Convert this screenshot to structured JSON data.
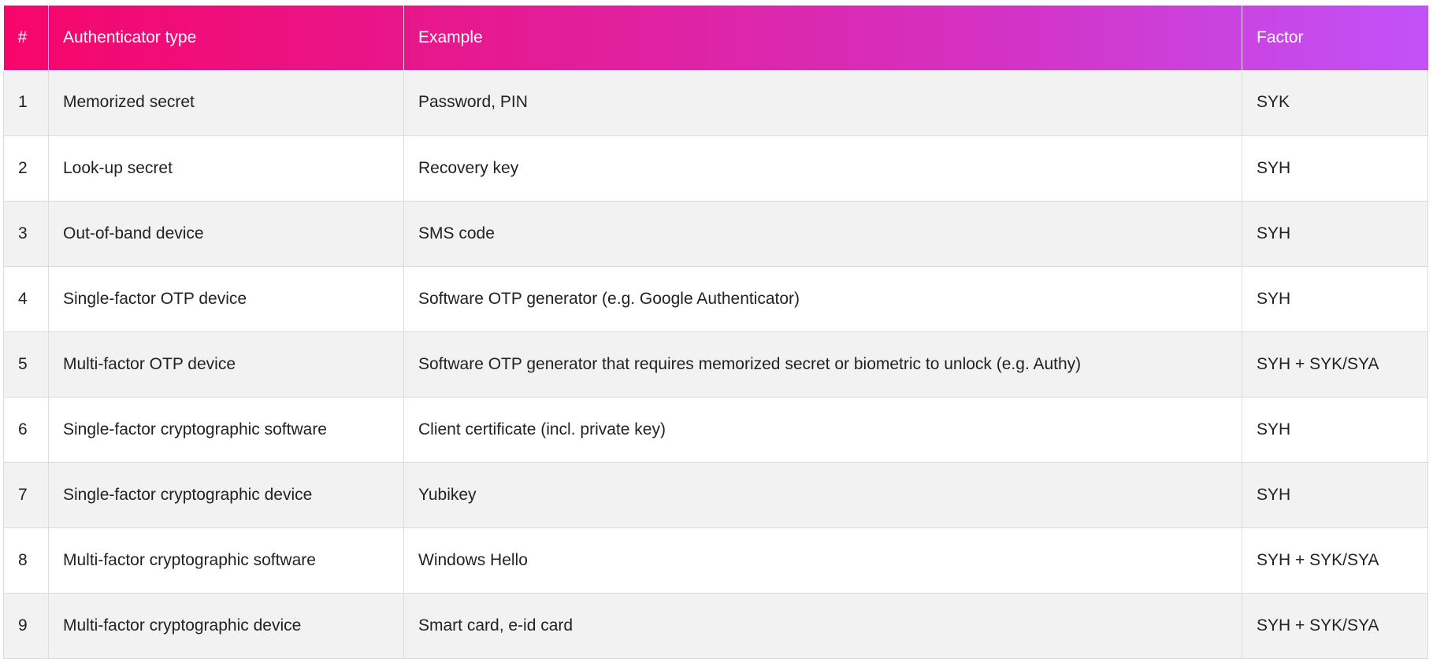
{
  "table": {
    "headers": [
      "#",
      "Authenticator type",
      "Example",
      "Factor"
    ],
    "rows": [
      [
        "1",
        "Memorized secret",
        "Password, PIN",
        "SYK"
      ],
      [
        "2",
        "Look-up secret",
        "Recovery key",
        "SYH"
      ],
      [
        "3",
        "Out-of-band device",
        "SMS code",
        "SYH"
      ],
      [
        "4",
        "Single-factor OTP device",
        "Software OTP generator (e.g. Google Authenticator)",
        "SYH"
      ],
      [
        "5",
        "Multi-factor OTP device",
        "Software OTP generator that requires memorized secret or biometric to unlock (e.g. Authy)",
        "SYH + SYK/SYA"
      ],
      [
        "6",
        "Single-factor cryptographic software",
        "Client certificate (incl. private key)",
        "SYH"
      ],
      [
        "7",
        "Single-factor cryptographic device",
        "Yubikey",
        "SYH"
      ],
      [
        "8",
        "Multi-factor cryptographic software",
        "Windows Hello",
        "SYH + SYK/SYA"
      ],
      [
        "9",
        "Multi-factor cryptographic device",
        "Smart card, e-id card",
        "SYH + SYK/SYA"
      ]
    ]
  },
  "colors": {
    "header_gradient_start": "#f6066b",
    "header_gradient_end": "#c152f9",
    "row_stripe": "#f2f2f2",
    "header_text": "#ffffff",
    "body_text": "#222222"
  }
}
